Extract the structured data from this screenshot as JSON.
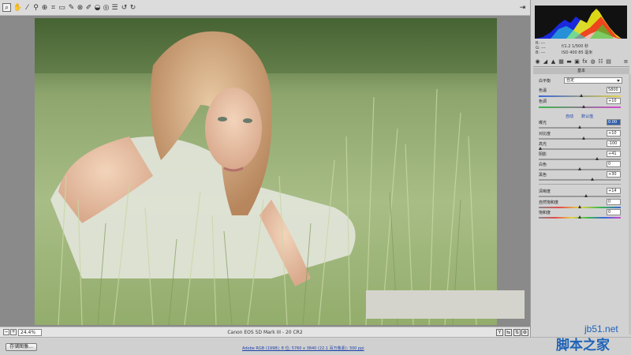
{
  "toolbar": {
    "tools": [
      "zoom-icon",
      "hand-icon",
      "white-balance-icon",
      "color-sampler-icon",
      "targeted-adjust-icon",
      "crop-icon",
      "straighten-icon",
      "spot-removal-icon",
      "red-eye-icon",
      "adjustment-brush-icon",
      "graduated-filter-icon",
      "radial-filter-icon",
      "preferences-icon",
      "rotate-left-icon",
      "rotate-right-icon"
    ],
    "fullscreen_icon": "fullscreen-icon"
  },
  "canvas": {
    "zoom_value": "24.4%",
    "camera_info": "Canon EOS 5D Mark III - 20 CR2"
  },
  "status": {
    "save_label": "存储图像...",
    "workflow_text": "Adobe RGB (1998); 8 位; 5760 x 3840 (22.1 百万像素); 300 ppi"
  },
  "exif": {
    "r": "R: ---",
    "g": "G: ---",
    "b": "B: ---",
    "aperture_shutter": "f/1.2  1/500 秒",
    "iso_focal": "ISO 400  85 毫米"
  },
  "panel": {
    "section_title": "基本",
    "white_balance_label": "白平衡",
    "white_balance_value": "自定",
    "temperature_label": "色温",
    "temperature_value": "5800",
    "tint_label": "色调",
    "tint_value": "+10",
    "auto_link": "自动",
    "default_link": "默认值",
    "exposure_label": "曝光",
    "exposure_value": "0.00",
    "contrast_label": "对比度",
    "contrast_value": "+10",
    "highlights_label": "高光",
    "highlights_value": "-100",
    "shadows_label": "阴影",
    "shadows_value": "+41",
    "whites_label": "白色",
    "whites_value": "0",
    "blacks_label": "黑色",
    "blacks_value": "+30",
    "clarity_label": "清晰度",
    "clarity_value": "+14",
    "vibrance_label": "自然饱和度",
    "vibrance_value": "0",
    "saturation_label": "饱和度",
    "saturation_value": "0"
  },
  "watermark": {
    "site": "jb51.net",
    "name": "脚本之家"
  }
}
